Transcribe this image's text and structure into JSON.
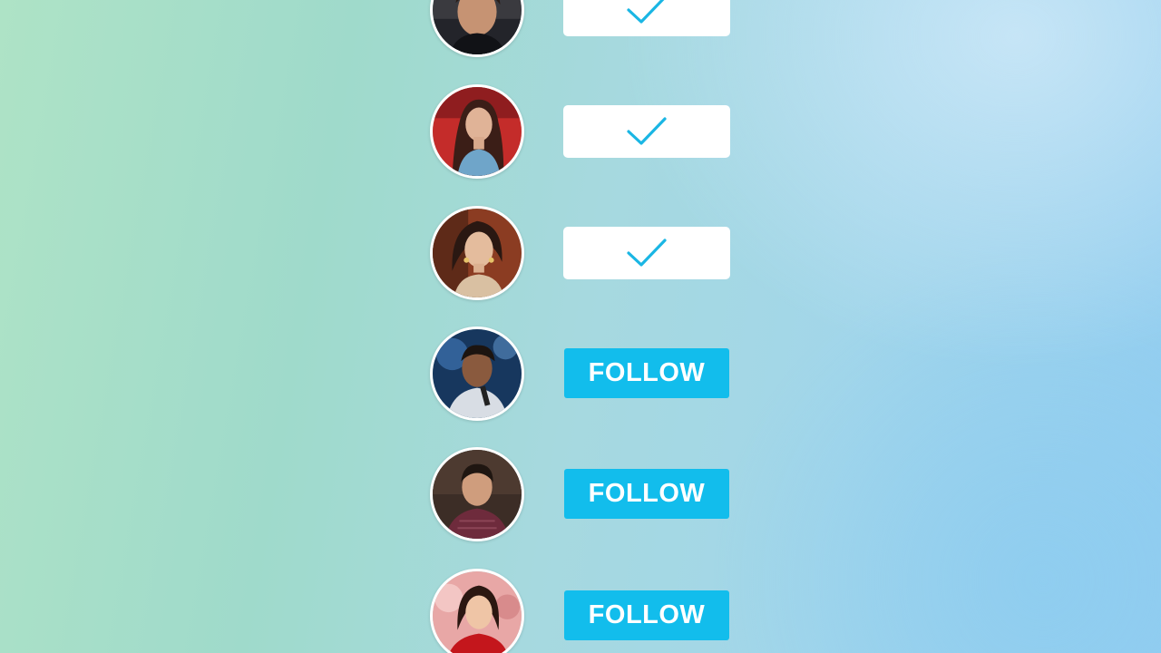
{
  "colors": {
    "follow_button": "#12bdec",
    "check_mark": "#1ab6e4",
    "done_button": "#ffffff",
    "avatar_border": "#ffffff"
  },
  "profiles": [
    {
      "avatar": "avatar-man-dark-hair",
      "state": "following",
      "icon": "check-icon"
    },
    {
      "avatar": "avatar-woman-red-background",
      "state": "following",
      "icon": "check-icon"
    },
    {
      "avatar": "avatar-woman-jewelry",
      "state": "following",
      "icon": "check-icon"
    },
    {
      "avatar": "avatar-man-microphone-blue-stage",
      "state": "not-following",
      "label": "FOLLOW"
    },
    {
      "avatar": "avatar-man-maroon-sweater",
      "state": "not-following",
      "label": "FOLLOW"
    },
    {
      "avatar": "avatar-woman-red-dress",
      "state": "not-following",
      "label": "FOLLOW"
    }
  ]
}
